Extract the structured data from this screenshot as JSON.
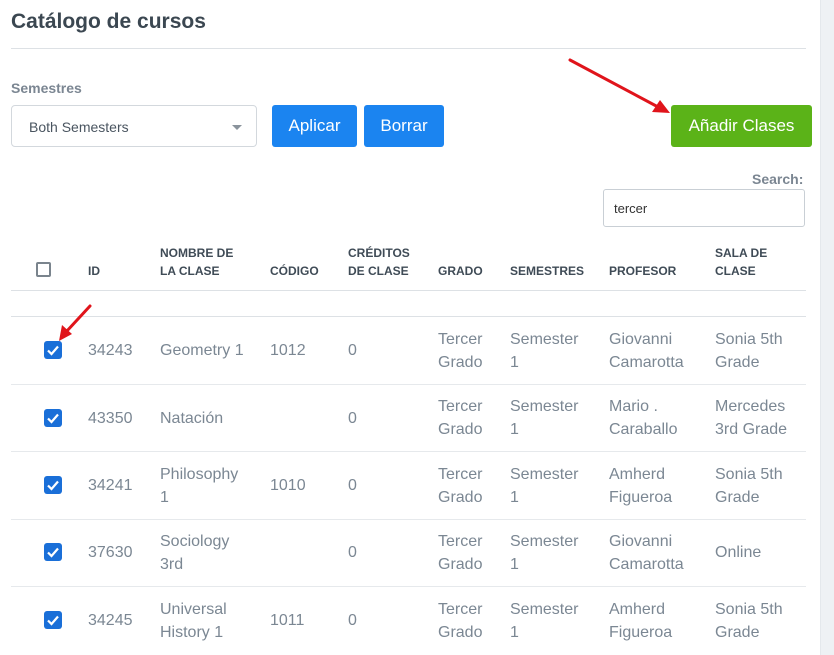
{
  "page": {
    "title": "Catálogo de cursos"
  },
  "filters": {
    "semester_label": "Semestres",
    "semester_value": "Both Semesters",
    "apply_label": "Aplicar",
    "clear_label": "Borrar",
    "add_label": "Añadir Clases"
  },
  "search": {
    "label": "Search:",
    "value": "tercer"
  },
  "table": {
    "headers": {
      "id": "ID",
      "name_1": "NOMBRE DE",
      "name_2": "LA CLASE",
      "code": "CÓDIGO",
      "credits_1": "CRÉDITOS",
      "credits_2": "DE CLASE",
      "grade": "GRADO",
      "semesters": "SEMESTRES",
      "teacher": "PROFESOR",
      "room_1": "SALA DE",
      "room_2": "CLASE"
    },
    "rows": [
      {
        "checked": true,
        "id": "34243",
        "name_1": "Geometry 1",
        "name_2": "",
        "code": "1012",
        "credits": "0",
        "grade_1": "Tercer",
        "grade_2": "Grado",
        "sem_1": "Semester",
        "sem_2": "1",
        "teacher_1": "Giovanni",
        "teacher_2": "Camarotta",
        "room_1": "Sonia 5th",
        "room_2": "Grade"
      },
      {
        "checked": true,
        "id": "43350",
        "name_1": "Natación",
        "name_2": "",
        "code": "",
        "credits": "0",
        "grade_1": "Tercer",
        "grade_2": "Grado",
        "sem_1": "Semester",
        "sem_2": "1",
        "teacher_1": "Mario .",
        "teacher_2": "Caraballo",
        "room_1": "Mercedes",
        "room_2": "3rd Grade"
      },
      {
        "checked": true,
        "id": "34241",
        "name_1": "Philosophy",
        "name_2": "1",
        "code": "1010",
        "credits": "0",
        "grade_1": "Tercer",
        "grade_2": "Grado",
        "sem_1": "Semester",
        "sem_2": "1",
        "teacher_1": "Amherd",
        "teacher_2": "Figueroa",
        "room_1": "Sonia 5th",
        "room_2": "Grade"
      },
      {
        "checked": true,
        "id": "37630",
        "name_1": "Sociology",
        "name_2": "3rd",
        "code": "",
        "credits": "0",
        "grade_1": "Tercer",
        "grade_2": "Grado",
        "sem_1": "Semester",
        "sem_2": "1",
        "teacher_1": "Giovanni",
        "teacher_2": "Camarotta",
        "room_1": "Online",
        "room_2": ""
      },
      {
        "checked": true,
        "id": "34245",
        "name_1": "Universal",
        "name_2": "History 1",
        "code": "1011",
        "credits": "0",
        "grade_1": "Tercer",
        "grade_2": "Grado",
        "sem_1": "Semester",
        "sem_2": "1",
        "teacher_1": "Amherd",
        "teacher_2": "Figueroa",
        "room_1": "Sonia 5th",
        "room_2": "Grade"
      }
    ]
  },
  "colors": {
    "primary": "#1b84f0",
    "success": "#5bb318",
    "checkbox": "#1a6fd8",
    "annotation": "#e0141b"
  },
  "icons": [
    "chevron-down-icon",
    "check-icon",
    "arrow-annotation-icon"
  ]
}
